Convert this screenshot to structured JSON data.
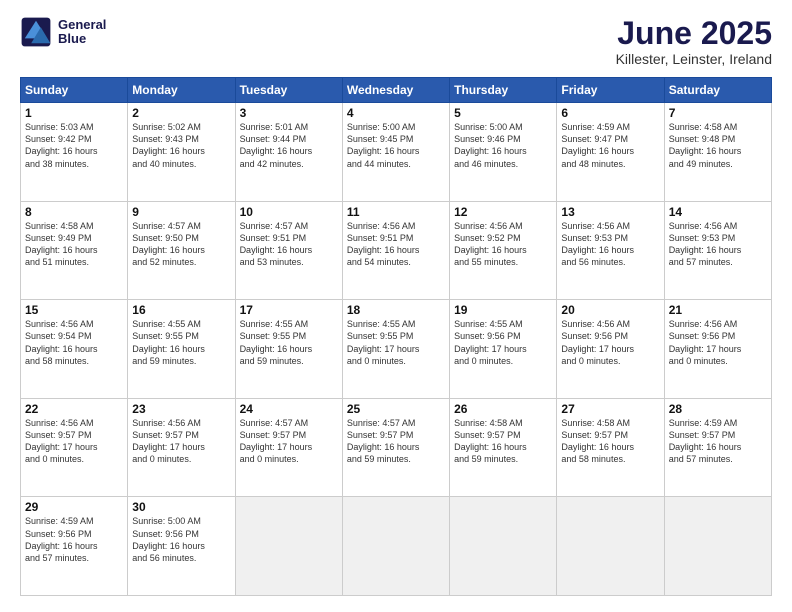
{
  "header": {
    "logo_line1": "General",
    "logo_line2": "Blue",
    "title": "June 2025",
    "subtitle": "Killester, Leinster, Ireland"
  },
  "calendar": {
    "days_of_week": [
      "Sunday",
      "Monday",
      "Tuesday",
      "Wednesday",
      "Thursday",
      "Friday",
      "Saturday"
    ],
    "weeks": [
      [
        null,
        null,
        null,
        null,
        null,
        null,
        {
          "day": 1,
          "rise": "5:03 AM",
          "set": "9:42 PM",
          "hours": 16,
          "minutes": 38
        }
      ],
      [
        {
          "day": 2,
          "rise": "5:02 AM",
          "set": "9:43 PM",
          "hours": 16,
          "minutes": 40
        },
        {
          "day": 3,
          "rise": "5:01 AM",
          "set": "9:44 PM",
          "hours": 16,
          "minutes": 42
        },
        {
          "day": 4,
          "rise": "5:00 AM",
          "set": "9:45 PM",
          "hours": 16,
          "minutes": 44
        },
        {
          "day": 5,
          "rise": "5:00 AM",
          "set": "9:46 PM",
          "hours": 16,
          "minutes": 46
        },
        {
          "day": 6,
          "rise": "4:59 AM",
          "set": "9:47 PM",
          "hours": 16,
          "minutes": 48
        },
        {
          "day": 7,
          "rise": "4:58 AM",
          "set": "9:48 PM",
          "hours": 16,
          "minutes": 49
        }
      ],
      [
        {
          "day": 8,
          "rise": "4:58 AM",
          "set": "9:49 PM",
          "hours": 16,
          "minutes": 51
        },
        {
          "day": 9,
          "rise": "4:57 AM",
          "set": "9:50 PM",
          "hours": 16,
          "minutes": 52
        },
        {
          "day": 10,
          "rise": "4:57 AM",
          "set": "9:51 PM",
          "hours": 16,
          "minutes": 53
        },
        {
          "day": 11,
          "rise": "4:56 AM",
          "set": "9:51 PM",
          "hours": 16,
          "minutes": 54
        },
        {
          "day": 12,
          "rise": "4:56 AM",
          "set": "9:52 PM",
          "hours": 16,
          "minutes": 55
        },
        {
          "day": 13,
          "rise": "4:56 AM",
          "set": "9:53 PM",
          "hours": 16,
          "minutes": 56
        },
        {
          "day": 14,
          "rise": "4:56 AM",
          "set": "9:53 PM",
          "hours": 16,
          "minutes": 57
        }
      ],
      [
        {
          "day": 15,
          "rise": "4:56 AM",
          "set": "9:54 PM",
          "hours": 16,
          "minutes": 58
        },
        {
          "day": 16,
          "rise": "4:55 AM",
          "set": "9:55 PM",
          "hours": 16,
          "minutes": 59
        },
        {
          "day": 17,
          "rise": "4:55 AM",
          "set": "9:55 PM",
          "hours": 16,
          "minutes": 59
        },
        {
          "day": 18,
          "rise": "4:55 AM",
          "set": "9:55 PM",
          "hours": 17,
          "minutes": 0
        },
        {
          "day": 19,
          "rise": "4:55 AM",
          "set": "9:56 PM",
          "hours": 17,
          "minutes": 0
        },
        {
          "day": 20,
          "rise": "4:56 AM",
          "set": "9:56 PM",
          "hours": 17,
          "minutes": 0
        },
        {
          "day": 21,
          "rise": "4:56 AM",
          "set": "9:56 PM",
          "hours": 17,
          "minutes": 0
        }
      ],
      [
        {
          "day": 22,
          "rise": "4:56 AM",
          "set": "9:57 PM",
          "hours": 17,
          "minutes": 0
        },
        {
          "day": 23,
          "rise": "4:56 AM",
          "set": "9:57 PM",
          "hours": 17,
          "minutes": 0
        },
        {
          "day": 24,
          "rise": "4:57 AM",
          "set": "9:57 PM",
          "hours": 17,
          "minutes": 0
        },
        {
          "day": 25,
          "rise": "4:57 AM",
          "set": "9:57 PM",
          "hours": 16,
          "minutes": 59
        },
        {
          "day": 26,
          "rise": "4:58 AM",
          "set": "9:57 PM",
          "hours": 16,
          "minutes": 59
        },
        {
          "day": 27,
          "rise": "4:58 AM",
          "set": "9:57 PM",
          "hours": 16,
          "minutes": 58
        },
        {
          "day": 28,
          "rise": "4:59 AM",
          "set": "9:57 PM",
          "hours": 16,
          "minutes": 57
        }
      ],
      [
        {
          "day": 29,
          "rise": "4:59 AM",
          "set": "9:56 PM",
          "hours": 16,
          "minutes": 57
        },
        {
          "day": 30,
          "rise": "5:00 AM",
          "set": "9:56 PM",
          "hours": 16,
          "minutes": 56
        },
        null,
        null,
        null,
        null,
        null
      ]
    ]
  }
}
